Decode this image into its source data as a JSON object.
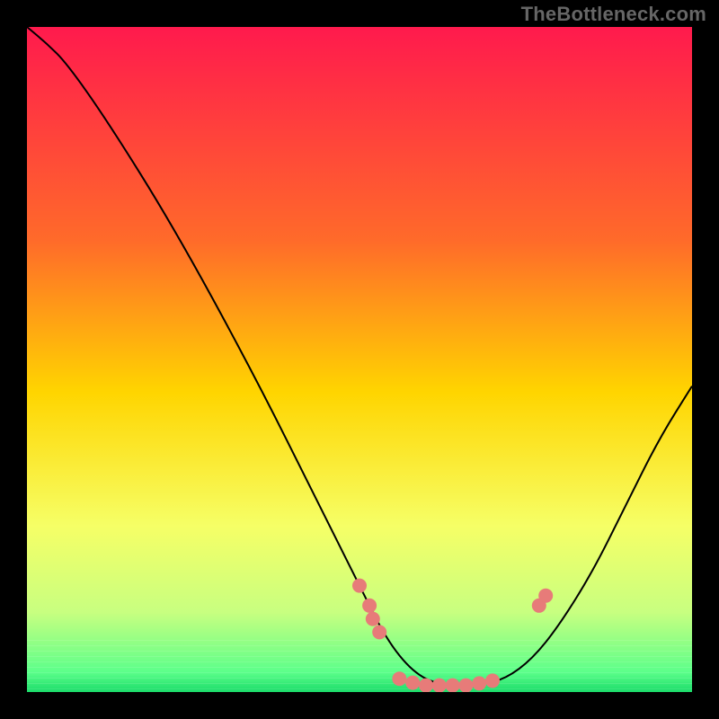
{
  "watermark": "TheBottleneck.com",
  "chart_data": {
    "type": "line",
    "title": "",
    "xlabel": "",
    "ylabel": "",
    "xlim": [
      0,
      100
    ],
    "ylim": [
      0,
      100
    ],
    "gradient_stops": [
      {
        "offset": 0,
        "color": "#ff1a4d"
      },
      {
        "offset": 0.32,
        "color": "#ff6a2a"
      },
      {
        "offset": 0.55,
        "color": "#ffd500"
      },
      {
        "offset": 0.75,
        "color": "#f6ff66"
      },
      {
        "offset": 0.88,
        "color": "#c8ff80"
      },
      {
        "offset": 0.97,
        "color": "#5cff8a"
      },
      {
        "offset": 1.0,
        "color": "#1bdc6a"
      }
    ],
    "curve": [
      {
        "x": 0,
        "y": 100
      },
      {
        "x": 3,
        "y": 97.5
      },
      {
        "x": 6,
        "y": 94.5
      },
      {
        "x": 12,
        "y": 86
      },
      {
        "x": 22,
        "y": 70
      },
      {
        "x": 34,
        "y": 48
      },
      {
        "x": 44,
        "y": 28
      },
      {
        "x": 50,
        "y": 16
      },
      {
        "x": 54,
        "y": 8
      },
      {
        "x": 58,
        "y": 3
      },
      {
        "x": 62,
        "y": 1
      },
      {
        "x": 68,
        "y": 1
      },
      {
        "x": 72,
        "y": 2
      },
      {
        "x": 76,
        "y": 5
      },
      {
        "x": 80,
        "y": 10
      },
      {
        "x": 85,
        "y": 18
      },
      {
        "x": 90,
        "y": 28
      },
      {
        "x": 95,
        "y": 38
      },
      {
        "x": 100,
        "y": 46
      }
    ],
    "points": [
      {
        "x": 50,
        "y": 16
      },
      {
        "x": 51.5,
        "y": 13
      },
      {
        "x": 52,
        "y": 11
      },
      {
        "x": 53,
        "y": 9
      },
      {
        "x": 56,
        "y": 2
      },
      {
        "x": 58,
        "y": 1.4
      },
      {
        "x": 60,
        "y": 1
      },
      {
        "x": 62,
        "y": 1
      },
      {
        "x": 64,
        "y": 1
      },
      {
        "x": 66,
        "y": 1
      },
      {
        "x": 68,
        "y": 1.3
      },
      {
        "x": 70,
        "y": 1.7
      },
      {
        "x": 77,
        "y": 13
      },
      {
        "x": 78,
        "y": 14.5
      }
    ],
    "point_color": "#e77b79",
    "point_radius": 8,
    "line_color": "#000000",
    "line_width": 2
  }
}
